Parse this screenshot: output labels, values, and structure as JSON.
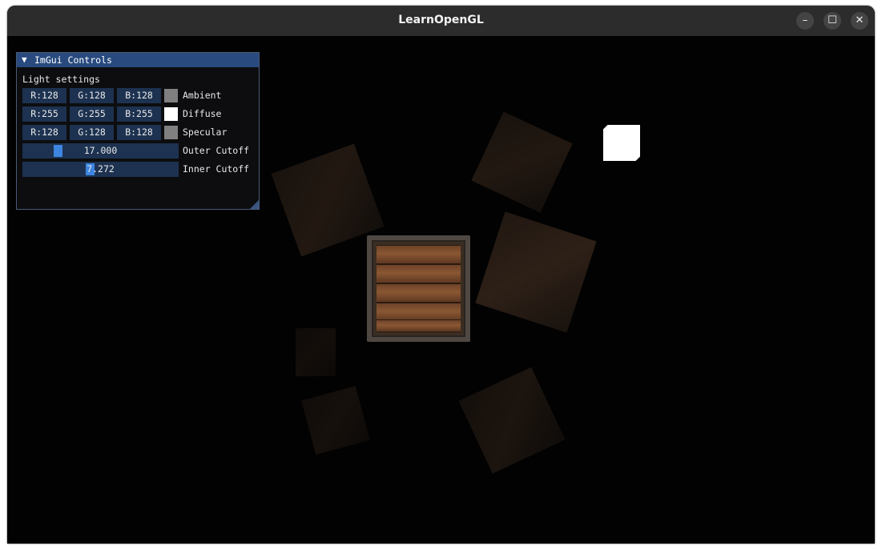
{
  "window": {
    "title": "LearnOpenGL",
    "controls": {
      "minimize": "–",
      "maximize": "☐",
      "close": "✕"
    }
  },
  "imgui": {
    "title": "ImGui Controls",
    "collapse_arrow": "▼",
    "section_label": "Light settings",
    "colors": [
      {
        "label": "Ambient",
        "r": "R:128",
        "g": "G:128",
        "b": "B:128",
        "swatch": "#808080"
      },
      {
        "label": "Diffuse",
        "r": "R:255",
        "g": "G:255",
        "b": "B:255",
        "swatch": "#ffffff"
      },
      {
        "label": "Specular",
        "r": "R:128",
        "g": "G:128",
        "b": "B:128",
        "swatch": "#808080"
      }
    ],
    "sliders": [
      {
        "label": "Outer Cutoff",
        "value": "17.000",
        "fraction": 0.21
      },
      {
        "label": "Inner Cutoff",
        "value": "7.272",
        "fraction": 0.43
      }
    ]
  },
  "colors": {
    "titlebar": "#2c2c2c",
    "imgui_title": "#284a7e",
    "widget_bg": "#1d3250",
    "slider_grab": "#3d85e0",
    "light_cube": "#ffffff"
  }
}
